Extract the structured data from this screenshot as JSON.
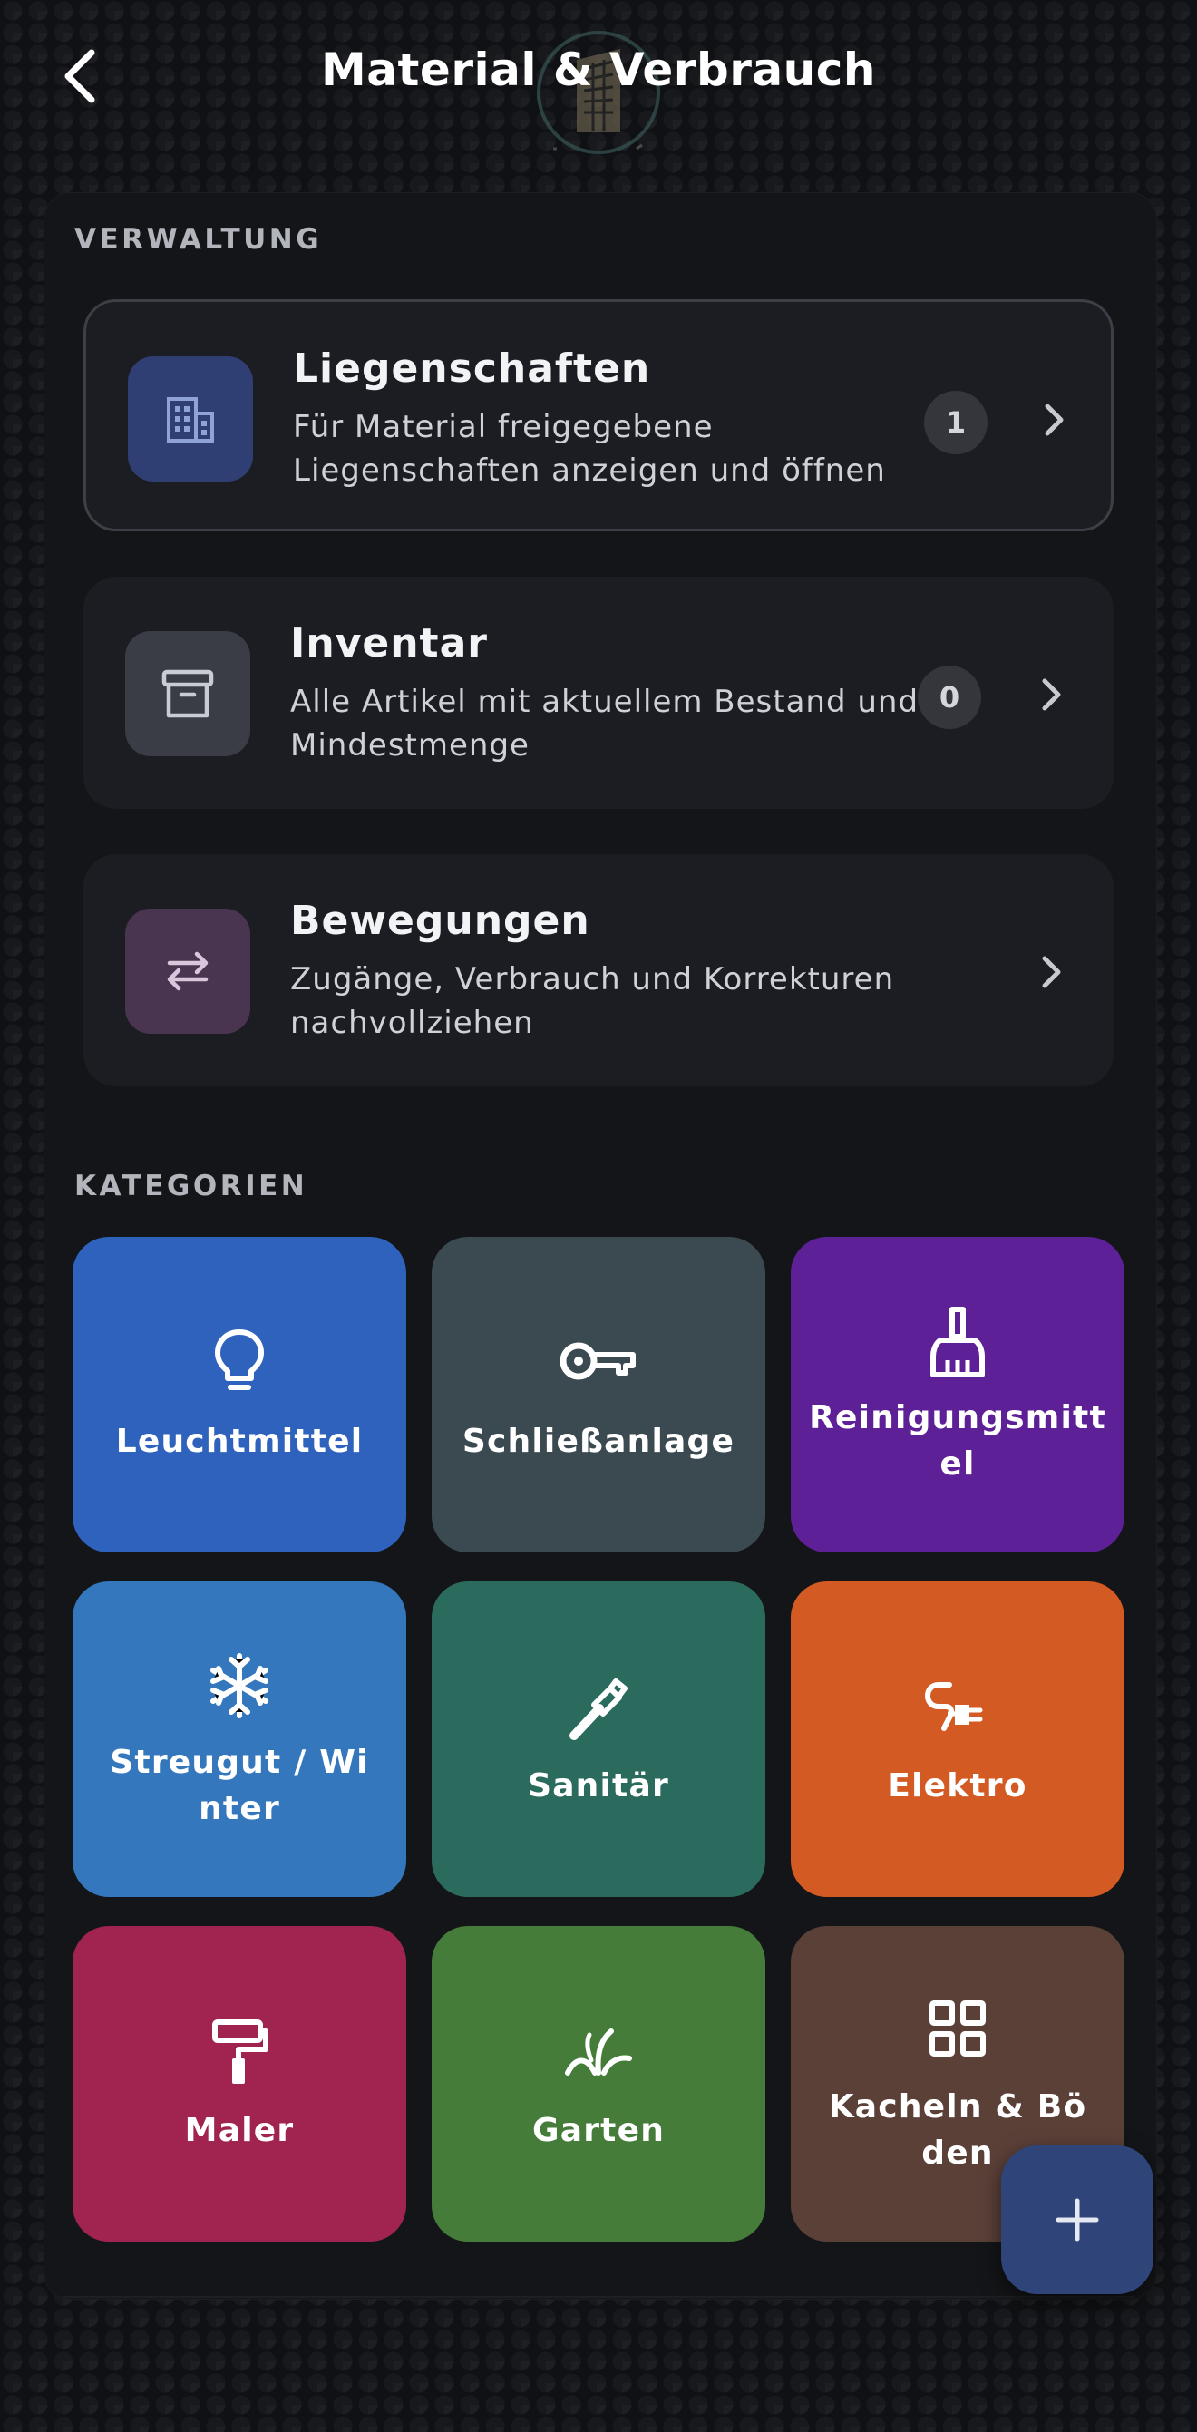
{
  "header": {
    "title": "Material & Verbrauch",
    "back_icon": "chevron-left-icon",
    "logo_icon": "building-logo-icon"
  },
  "verwaltung": {
    "section_label": "VERWALTUNG",
    "cards": [
      {
        "title": "Liegenschaften",
        "description": "Für Material freigegebene Liegenschaften anzeigen und öffnen",
        "badge": "1",
        "icon": "building-icon",
        "icon_bg": "#2f3f73"
      },
      {
        "title": "Inventar",
        "description": "Alle Artikel mit aktuellem Bestand und Mindestmenge",
        "badge": "0",
        "icon": "archive-box-icon",
        "icon_bg": "#3a3d46"
      },
      {
        "title": "Bewegungen",
        "description": "Zugänge, Verbrauch und Korrekturen nachvollziehen",
        "icon": "swap-arrows-icon",
        "icon_bg": "#4a3550"
      }
    ]
  },
  "kategorien": {
    "section_label": "KATEGORIEN",
    "tiles": [
      {
        "label": "Leuchtmittel",
        "icon": "lightbulb-icon",
        "color": "#2f62bc"
      },
      {
        "label": "Schließanlage",
        "icon": "key-icon",
        "color": "#3b4950"
      },
      {
        "label": "Reinigungsmittel",
        "icon": "broom-icon",
        "color": "#5e2096"
      },
      {
        "label": "Streugut / Winter",
        "icon": "snowflake-icon",
        "color": "#3477bc"
      },
      {
        "label": "Sanitär",
        "icon": "pipe-wrench-icon",
        "color": "#2a6b5d"
      },
      {
        "label": "Elektro",
        "icon": "plug-icon",
        "color": "#d45a24"
      },
      {
        "label": "Maler",
        "icon": "paint-roller-icon",
        "color": "#a0244f"
      },
      {
        "label": "Garten",
        "icon": "grass-icon",
        "color": "#457c3a"
      },
      {
        "label": "Kacheln & Böden",
        "icon": "tiles-grid-icon",
        "color": "#5b4038"
      }
    ]
  },
  "fab": {
    "icon": "plus-icon",
    "label": "+"
  }
}
